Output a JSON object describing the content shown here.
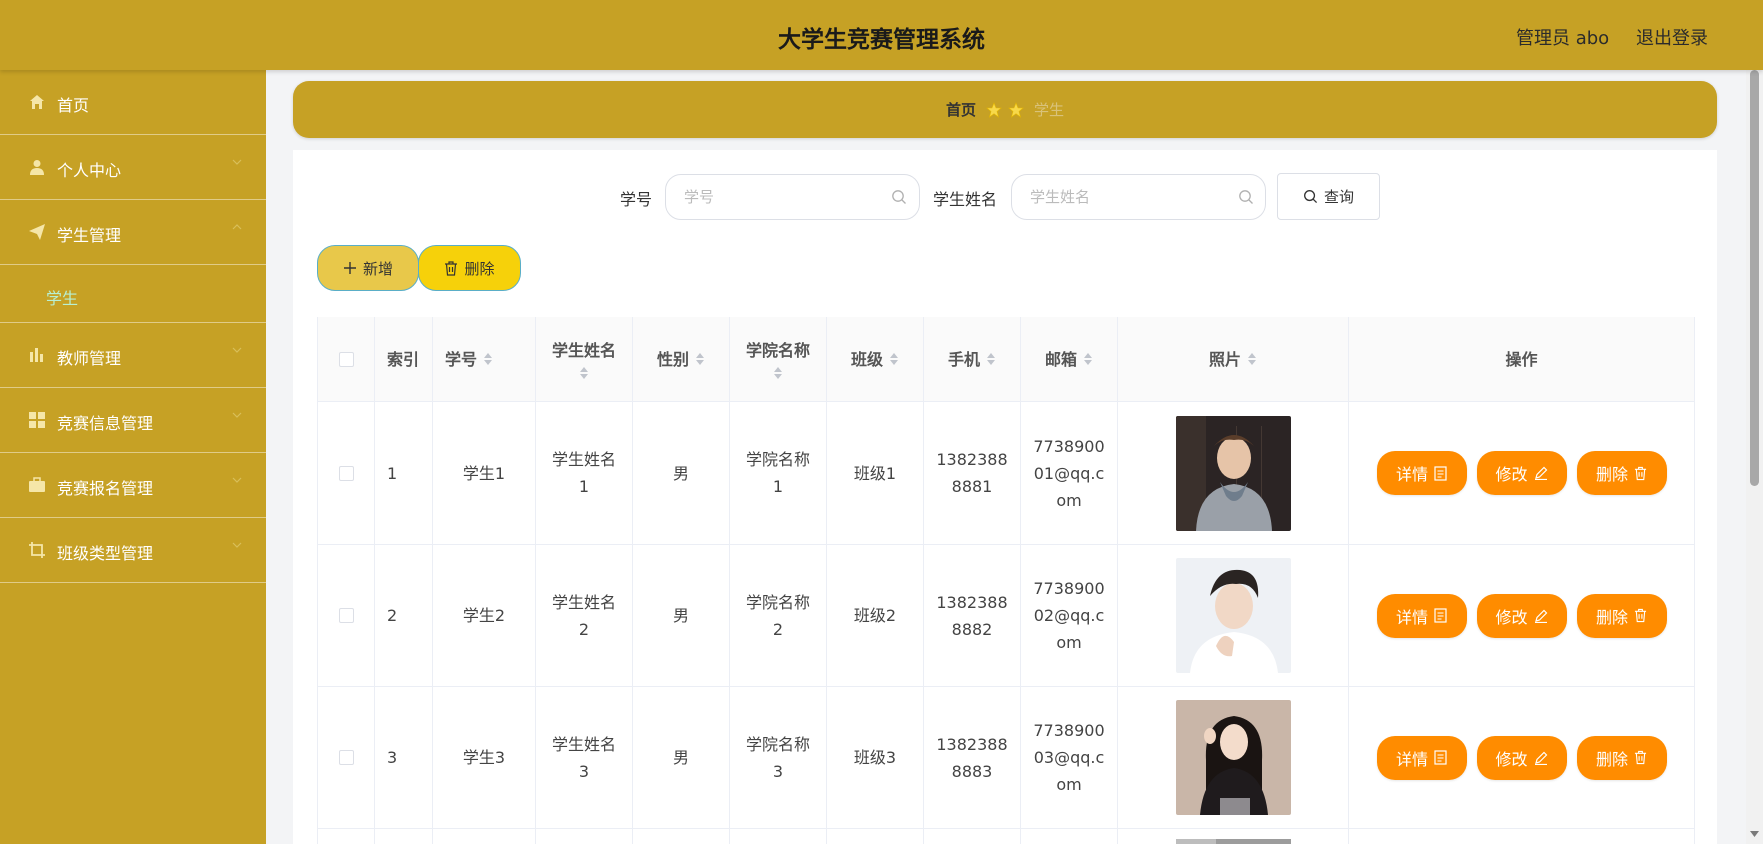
{
  "header": {
    "title": "大学生竞赛管理系统",
    "admin": "管理员 abo",
    "logout": "退出登录"
  },
  "sidebar": {
    "items": [
      {
        "label": "首页",
        "icon": "home-icon"
      },
      {
        "label": "个人中心",
        "icon": "user-icon"
      },
      {
        "label": "学生管理",
        "icon": "paper-plane-icon"
      },
      {
        "label": "学生",
        "sub": true
      },
      {
        "label": "教师管理",
        "icon": "bar-chart-icon"
      },
      {
        "label": "竞赛信息管理",
        "icon": "grid-icon"
      },
      {
        "label": "竞赛报名管理",
        "icon": "briefcase-icon"
      },
      {
        "label": "班级类型管理",
        "icon": "crop-icon"
      }
    ]
  },
  "breadcrumb": {
    "home": "首页",
    "current": "学生"
  },
  "search": {
    "id_label": "学号",
    "id_placeholder": "学号",
    "name_label": "学生姓名",
    "name_placeholder": "学生姓名",
    "query_label": "查询"
  },
  "actions": {
    "add_label": "新增",
    "delete_label": "删除"
  },
  "colors": {
    "accent": "#c6a125",
    "op_button": "#ff8c00"
  },
  "table": {
    "headers": {
      "index": "索引",
      "student_id": "学号",
      "student_name": "学生姓名",
      "gender": "性别",
      "college": "学院名称",
      "class": "班级",
      "phone": "手机",
      "email": "邮箱",
      "photo": "照片",
      "actions": "操作"
    },
    "rows": [
      {
        "index": "1",
        "student_id": "学生1",
        "student_name": "学生姓名1",
        "gender": "男",
        "college": "学院名称1",
        "class": "班级1",
        "phone": "13823888881",
        "email": "773890001@qq.com"
      },
      {
        "index": "2",
        "student_id": "学生2",
        "student_name": "学生姓名2",
        "gender": "男",
        "college": "学院名称2",
        "class": "班级2",
        "phone": "13823888882",
        "email": "773890002@qq.com"
      },
      {
        "index": "3",
        "student_id": "学生3",
        "student_name": "学生姓名3",
        "gender": "男",
        "college": "学院名称3",
        "class": "班级3",
        "phone": "13823888883",
        "email": "773890003@qq.com"
      }
    ],
    "buttons": {
      "detail": "详情",
      "edit": "修改",
      "delete": "删除"
    }
  }
}
